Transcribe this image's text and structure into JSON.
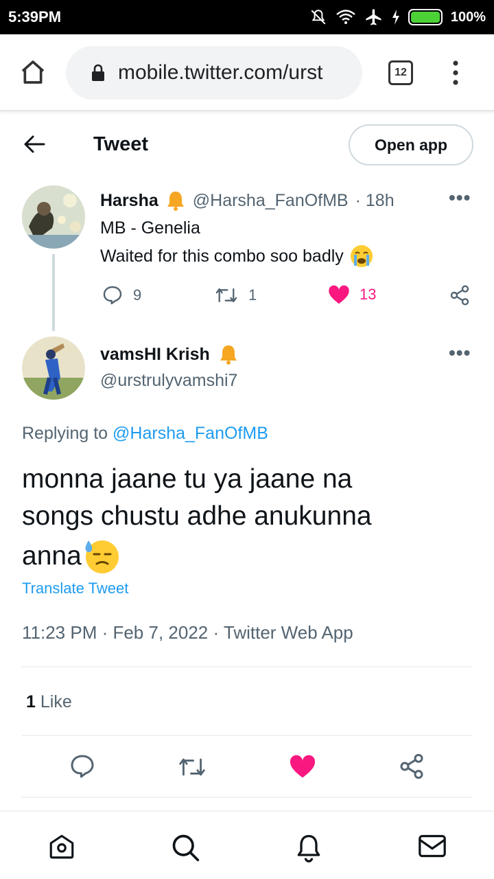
{
  "status_bar": {
    "time": "5:39PM",
    "battery": "100%"
  },
  "browser": {
    "url": "mobile.twitter.com/urst",
    "tab_count": "12"
  },
  "header": {
    "title": "Tweet",
    "open_app_label": "Open app"
  },
  "parent_tweet": {
    "name": "Harsha",
    "handle": "@Harsha_FanOfMB",
    "time": "· 18h",
    "line1": "MB - Genelia",
    "line2": "Waited for this combo soo badly",
    "replies": "9",
    "retweets": "1",
    "likes": "13"
  },
  "main_tweet": {
    "name": "vamsHI Krish",
    "handle": "@urstrulyvamshi7",
    "replying_prefix": "Replying to",
    "replying_handle": "@Harsha_FanOfMB",
    "text_line1": "monna jaane tu ya jaane na",
    "text_line2": "songs chustu adhe anukunna",
    "text_line3": "anna",
    "translate_label": "Translate Tweet",
    "timestamp": "11:23 PM · Feb 7, 2022 · Twitter Web App",
    "like_count": "1",
    "like_label": "Like"
  },
  "colors": {
    "accent": "#1d9bf0",
    "like": "#f91880",
    "muted": "#536471"
  }
}
